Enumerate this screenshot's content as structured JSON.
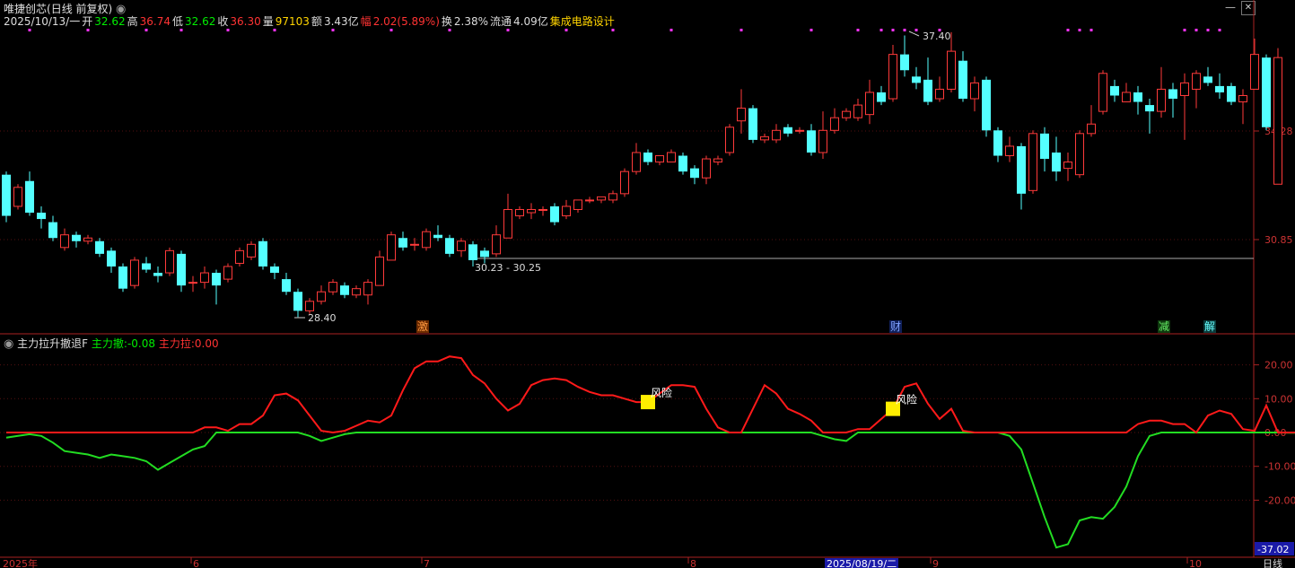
{
  "header": {
    "stock_name": "唯捷创芯",
    "period": "(日线 前复权)",
    "date": "2025/10/13/一",
    "open_label": "开",
    "open": "32.62",
    "high_label": "高",
    "high": "36.74",
    "low_label": "低",
    "low": "32.62",
    "close_label": "收",
    "close": "36.30",
    "volume_label": "量",
    "volume": "97103",
    "amount_label": "额",
    "amount": "3.43亿",
    "change_label": "幅",
    "change": "2.02(5.89%)",
    "turnover_label": "换",
    "turnover": "2.38%",
    "float_label": "流通",
    "float_value": "4.09亿",
    "sector": "集成电路设计"
  },
  "window_controls": {
    "minimize": "—",
    "close": "✕"
  },
  "price_axis": {
    "levels": [
      "34.28",
      "30.85"
    ]
  },
  "price_annotations": {
    "high": "37.40",
    "low": "28.40",
    "range": "30.23 - 30.25"
  },
  "event_badges": [
    {
      "text": "激",
      "color": "#ff6600"
    },
    {
      "text": "财",
      "color": "#3366ff"
    },
    {
      "text": "减",
      "color": "#33cc33"
    },
    {
      "text": "解",
      "color": "#00aaaa"
    }
  ],
  "indicator": {
    "name": "主力拉升撤退F",
    "line1_label": "主力撤:",
    "line1_value": "-0.08",
    "line2_label": "主力拉:",
    "line2_value": "0.00",
    "axis_levels": [
      "20.00",
      "10.00",
      "0.00",
      "-10.00",
      "-20.00"
    ],
    "current_value": "-37.02",
    "signal_text": "风险"
  },
  "date_axis": {
    "labels": [
      "2025年",
      "6",
      "7",
      "8",
      "2025/08/19/二",
      "9",
      "10"
    ],
    "period_tab": "日线"
  },
  "colors": {
    "up": "#ff3a3a",
    "down": "#54ffff",
    "line_red": "#ff1a1a",
    "line_green": "#22dd22",
    "axis": "#aa2222",
    "signal": "#ffee00",
    "dot": "#ff33ff"
  },
  "chart_data": [
    {
      "type": "candlestick",
      "title": "唯捷创芯",
      "price_range": [
        27.5,
        38.2
      ],
      "candles": [
        [
          32.9,
          31.6,
          33.0,
          31.4
        ],
        [
          31.9,
          32.5,
          32.6,
          31.8
        ],
        [
          32.7,
          31.7,
          33.0,
          31.6
        ],
        [
          31.7,
          31.5,
          31.9,
          31.2
        ],
        [
          31.4,
          30.9,
          31.6,
          30.8
        ],
        [
          30.6,
          31.0,
          31.2,
          30.5
        ],
        [
          31.0,
          30.8,
          31.1,
          30.6
        ],
        [
          30.8,
          30.9,
          31.0,
          30.7
        ],
        [
          30.8,
          30.4,
          30.9,
          30.3
        ],
        [
          30.5,
          30.0,
          30.6,
          29.8
        ],
        [
          30.0,
          29.3,
          30.1,
          29.2
        ],
        [
          29.4,
          30.2,
          30.3,
          29.3
        ],
        [
          30.1,
          29.9,
          30.3,
          29.8
        ],
        [
          29.8,
          29.7,
          30.0,
          29.5
        ],
        [
          29.8,
          30.5,
          30.6,
          29.7
        ],
        [
          30.4,
          29.4,
          30.5,
          29.2
        ],
        [
          29.5,
          29.5,
          29.7,
          29.2
        ],
        [
          29.5,
          29.8,
          30.0,
          29.3
        ],
        [
          29.8,
          29.4,
          29.9,
          28.8
        ],
        [
          29.6,
          30.0,
          30.1,
          29.5
        ],
        [
          30.1,
          30.5,
          30.6,
          30.0
        ],
        [
          30.3,
          30.7,
          30.8,
          30.2
        ],
        [
          30.8,
          30.0,
          30.9,
          29.9
        ],
        [
          30.0,
          29.8,
          30.1,
          29.6
        ],
        [
          29.6,
          29.2,
          29.8,
          29.1
        ],
        [
          29.2,
          28.6,
          29.3,
          28.4
        ],
        [
          28.6,
          28.9,
          29.0,
          28.5
        ],
        [
          28.9,
          29.2,
          29.4,
          28.8
        ],
        [
          29.2,
          29.5,
          29.6,
          29.1
        ],
        [
          29.4,
          29.1,
          29.5,
          29.0
        ],
        [
          29.1,
          29.3,
          29.4,
          29.0
        ],
        [
          29.1,
          29.5,
          29.6,
          28.8
        ],
        [
          29.4,
          30.3,
          30.5,
          29.4
        ],
        [
          30.2,
          31.0,
          31.1,
          30.2
        ],
        [
          30.9,
          30.6,
          31.1,
          30.5
        ],
        [
          30.7,
          30.7,
          30.9,
          30.5
        ],
        [
          30.6,
          31.1,
          31.2,
          30.5
        ],
        [
          31.0,
          30.9,
          31.3,
          30.8
        ],
        [
          30.9,
          30.4,
          31.0,
          30.3
        ],
        [
          30.5,
          30.8,
          30.9,
          30.3
        ],
        [
          30.7,
          30.2,
          30.8,
          30.0
        ],
        [
          30.5,
          30.3,
          30.6,
          30.1
        ],
        [
          30.4,
          31.0,
          31.3,
          30.3
        ],
        [
          30.9,
          31.8,
          32.3,
          30.9
        ],
        [
          31.6,
          31.8,
          31.9,
          31.5
        ],
        [
          31.7,
          31.8,
          32.0,
          31.5
        ],
        [
          31.8,
          31.8,
          31.9,
          31.6
        ],
        [
          31.9,
          31.4,
          32.0,
          31.3
        ],
        [
          31.6,
          31.9,
          32.1,
          31.5
        ],
        [
          31.8,
          32.1,
          32.1,
          31.7
        ],
        [
          32.1,
          32.1,
          32.2,
          32.0
        ],
        [
          32.1,
          32.2,
          32.2,
          32.0
        ],
        [
          32.1,
          32.3,
          32.4,
          32.0
        ],
        [
          32.3,
          33.0,
          33.1,
          32.2
        ],
        [
          33.0,
          33.6,
          33.9,
          32.9
        ],
        [
          33.6,
          33.3,
          33.7,
          33.2
        ],
        [
          33.3,
          33.5,
          33.5,
          33.2
        ],
        [
          33.3,
          33.6,
          33.7,
          33.3
        ],
        [
          33.5,
          33.0,
          33.6,
          32.9
        ],
        [
          33.1,
          32.8,
          33.2,
          32.6
        ],
        [
          32.8,
          33.4,
          33.5,
          32.6
        ],
        [
          33.3,
          33.4,
          33.5,
          33.2
        ],
        [
          33.6,
          34.4,
          34.5,
          33.5
        ],
        [
          34.6,
          35.0,
          35.6,
          34.2
        ],
        [
          35.0,
          34.0,
          35.1,
          33.9
        ],
        [
          34.0,
          34.1,
          34.2,
          33.9
        ],
        [
          34.0,
          34.3,
          34.5,
          33.9
        ],
        [
          34.4,
          34.2,
          34.5,
          34.1
        ],
        [
          34.3,
          34.3,
          34.4,
          34.2
        ],
        [
          34.3,
          33.6,
          34.5,
          33.5
        ],
        [
          33.6,
          34.3,
          34.9,
          33.4
        ],
        [
          34.3,
          34.7,
          35.0,
          34.2
        ],
        [
          34.7,
          34.9,
          35.0,
          34.6
        ],
        [
          34.7,
          35.1,
          35.3,
          34.6
        ],
        [
          34.8,
          35.5,
          35.9,
          34.5
        ],
        [
          35.5,
          35.2,
          35.7,
          35.1
        ],
        [
          35.3,
          36.7,
          37.0,
          35.2
        ],
        [
          36.7,
          36.2,
          37.3,
          36.0
        ],
        [
          36.0,
          35.8,
          36.3,
          35.6
        ],
        [
          35.9,
          35.2,
          36.6,
          35.1
        ],
        [
          35.3,
          35.6,
          36.0,
          35.2
        ],
        [
          35.6,
          36.8,
          37.4,
          35.5
        ],
        [
          36.5,
          35.3,
          36.8,
          35.2
        ],
        [
          35.3,
          35.8,
          36.0,
          34.9
        ],
        [
          35.9,
          34.3,
          36.0,
          34.1
        ],
        [
          34.3,
          33.5,
          34.4,
          33.3
        ],
        [
          33.5,
          33.8,
          34.1,
          33.3
        ],
        [
          33.8,
          32.3,
          33.9,
          31.8
        ],
        [
          32.4,
          34.2,
          34.3,
          32.3
        ],
        [
          34.2,
          33.4,
          34.4,
          33.0
        ],
        [
          33.6,
          33.0,
          34.1,
          32.7
        ],
        [
          33.1,
          33.3,
          33.6,
          32.7
        ],
        [
          32.9,
          34.2,
          34.3,
          32.8
        ],
        [
          34.2,
          34.5,
          35.1,
          34.1
        ],
        [
          34.9,
          36.1,
          36.2,
          34.8
        ],
        [
          35.7,
          35.4,
          35.9,
          35.2
        ],
        [
          35.2,
          35.5,
          35.8,
          35.2
        ],
        [
          35.5,
          35.2,
          35.7,
          34.8
        ],
        [
          35.1,
          34.9,
          35.3,
          34.2
        ],
        [
          34.9,
          35.6,
          36.3,
          34.7
        ],
        [
          35.6,
          35.3,
          35.8,
          34.7
        ],
        [
          35.4,
          35.8,
          36.1,
          34.0
        ],
        [
          35.6,
          36.1,
          36.2,
          35.0
        ],
        [
          36.0,
          35.8,
          36.3,
          35.7
        ],
        [
          35.7,
          35.5,
          36.1,
          35.3
        ],
        [
          35.7,
          35.2,
          35.8,
          35.1
        ],
        [
          35.2,
          35.4,
          35.6,
          34.5
        ],
        [
          35.6,
          36.7,
          37.2,
          35.6
        ],
        [
          36.6,
          34.4,
          36.7,
          34.3
        ],
        [
          32.6,
          36.6,
          36.9,
          32.6
        ]
      ]
    },
    {
      "type": "line",
      "title": "主力拉升撤退F",
      "ylim": [
        -37.02,
        25
      ],
      "series": [
        {
          "name": "主力撤",
          "values": [
            -1.5,
            -1,
            -0.5,
            -1,
            -3,
            -5.5,
            -6,
            -6.5,
            -7.5,
            -6.5,
            -7,
            -7.5,
            -8.5,
            -11,
            -9,
            -7,
            -5,
            -4,
            0,
            0,
            0,
            0,
            0,
            0,
            0,
            0,
            -1,
            -2.5,
            -1.5,
            -0.5,
            0,
            0,
            0,
            0,
            0,
            0,
            0,
            0,
            0,
            0,
            0,
            0,
            0,
            0,
            0,
            0,
            0,
            0,
            0,
            0,
            0,
            0,
            0,
            0,
            0,
            0,
            0,
            0,
            0,
            0,
            0,
            0,
            0,
            0,
            0,
            0,
            0,
            0,
            0,
            0,
            -1,
            -2,
            -2.5,
            0,
            0,
            0,
            0,
            0,
            0,
            0,
            0,
            0,
            0,
            0,
            0,
            0,
            -1,
            -5,
            -15,
            -25,
            -34,
            -33,
            -26,
            -25,
            -25.5,
            -22,
            -16,
            -7,
            -1,
            0,
            0,
            0,
            0,
            0,
            0,
            0,
            0,
            0,
            0,
            0,
            -0.08,
            -0.08
          ]
        },
        {
          "name": "主力拉",
          "values": [
            0,
            0,
            0,
            0,
            0,
            0,
            0,
            0,
            0,
            0,
            0,
            0,
            0,
            0,
            0,
            0,
            0,
            1.5,
            1.5,
            0.5,
            2.5,
            2.5,
            5,
            11,
            11.5,
            9.5,
            5,
            0.5,
            0,
            0.5,
            2,
            3.5,
            3,
            5,
            12.5,
            19,
            21,
            21,
            22.5,
            22,
            17,
            14.5,
            10,
            6.5,
            8.5,
            14,
            15.5,
            16,
            15.5,
            13.5,
            12,
            11,
            11,
            10,
            9,
            9,
            11.5,
            14,
            14,
            13.5,
            7,
            1.5,
            0,
            0,
            7,
            14,
            11.5,
            7,
            5.5,
            3.5,
            0,
            0,
            0,
            1,
            1,
            4,
            7,
            13.5,
            14.5,
            8.5,
            4,
            7,
            0.5,
            0,
            0,
            0,
            0,
            0,
            0,
            0,
            0,
            0,
            0,
            0,
            0,
            0,
            0,
            2.5,
            3.5,
            3.5,
            2.5,
            2.5,
            0,
            5,
            6.5,
            5.5,
            1,
            0.5,
            8,
            0,
            0,
            0
          ]
        }
      ],
      "signals": [
        {
          "index": 55,
          "text": "风险"
        },
        {
          "index": 76,
          "text": "风险"
        }
      ]
    }
  ]
}
